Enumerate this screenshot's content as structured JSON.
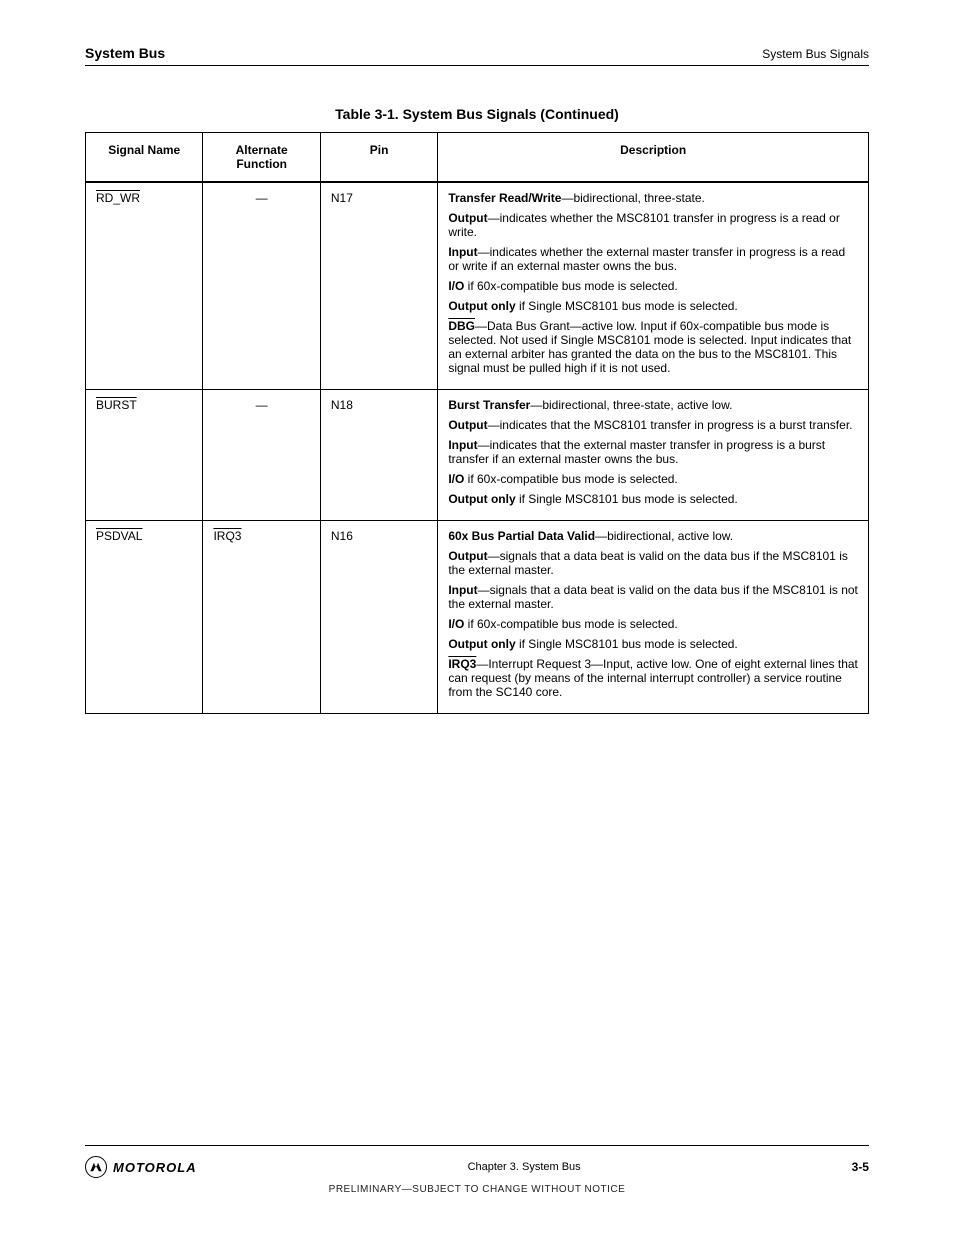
{
  "header": {
    "chapter": "System Bus",
    "section": "System Bus Signals"
  },
  "table": {
    "caption": "Table 3-1.   System Bus Signals (Continued)",
    "headers": [
      "Signal Name",
      "Alternate Function",
      "Pin",
      "Description"
    ],
    "rows": [
      {
        "signal": "RD_WR",
        "alternate": "—",
        "pin": "N17",
        "description_items": [
          {
            "label": "Transfer Read/Write",
            "text": "—bidirectional, three-state."
          },
          {
            "label": "Output",
            "text": "—indicates whether the MSC8101 transfer in progress is a read or write."
          },
          {
            "label": "Input",
            "text": "—indicates whether the external master transfer in progress is a read or write if an external master owns the bus."
          },
          {
            "label": "I/O",
            "text": " if 60x-compatible bus mode is selected."
          },
          {
            "label": "Output only",
            "text": " if Single MSC8101 bus mode is selected."
          },
          {
            "label": "<b><span style=\"text-decoration:overline\">DBG</span></b>—Data Bus Grant",
            "text": "—active low. Input if 60x-compatible bus mode is selected. Not used if Single MSC8101 mode is selected. Input indicates that an external arbiter has granted the data on the bus to the MSC8101. This signal must be pulled high if it is not used."
          }
        ]
      },
      {
        "signal": "BURST",
        "alternate": "—",
        "pin": "N18",
        "description_items": [
          {
            "label": "Burst Transfer",
            "text": "—bidirectional, three-state, active low."
          },
          {
            "label": "Output",
            "text": "—indicates that the MSC8101 transfer in progress is a burst transfer."
          },
          {
            "label": "Input",
            "text": "—indicates that the external master transfer in progress is a burst transfer if an external master owns the bus."
          },
          {
            "label": "I/O",
            "text": " if 60x-compatible bus mode is selected."
          },
          {
            "label": "Output only",
            "text": " if Single MSC8101 bus mode is selected."
          }
        ]
      },
      {
        "signal": "PSDVAL",
        "alternate": "IRQ3",
        "pin": "N16",
        "description_items": [
          {
            "label": "60x Bus Partial Data Valid",
            "text": "—bidirectional, active low."
          },
          {
            "label": "Output",
            "text": "—signals that a data beat is valid on the data bus if the MSC8101 is the external master."
          },
          {
            "label": "Input",
            "text": "—signals that a data beat is valid on the data bus if the MSC8101 is not the external master."
          },
          {
            "label": "I/O",
            "text": " if 60x-compatible bus mode is selected."
          },
          {
            "label": "Output only",
            "text": " if Single MSC8101 bus mode is selected."
          },
          {
            "label": "<b><span style=\"text-decoration:overline\">IRQ3</span></b>—Interrupt Request 3",
            "text": "—Input, active low. One of eight external lines that can request (by means of the internal interrupt controller) a service routine from the SC140 core."
          }
        ]
      }
    ]
  },
  "footer": {
    "brand": "MOTOROLA",
    "chapter_label": "Chapter 3.  System Bus",
    "page": "3-5",
    "note": "PRELIMINARY—SUBJECT TO CHANGE WITHOUT NOTICE"
  }
}
